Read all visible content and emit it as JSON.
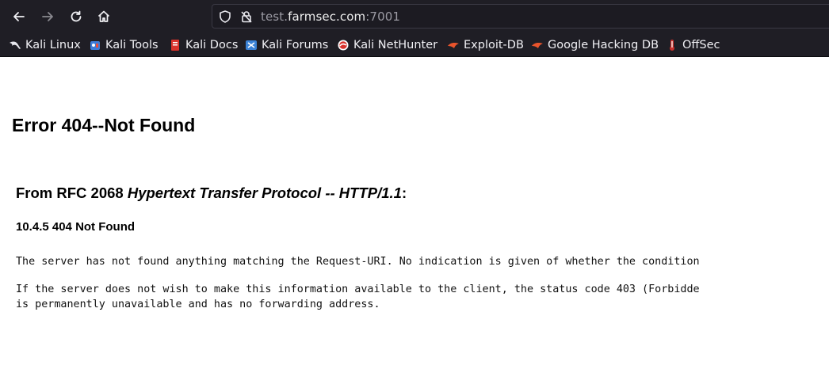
{
  "browser": {
    "url_subdomain": "test.",
    "url_domain": "farmsec.com",
    "url_port": ":7001",
    "bookmarks": [
      {
        "label": "Kali Linux",
        "icon": "kali-dragon-icon"
      },
      {
        "label": "Kali Tools",
        "icon": "kali-tools-icon"
      },
      {
        "label": "Kali Docs",
        "icon": "kali-docs-icon"
      },
      {
        "label": "Kali Forums",
        "icon": "kali-forums-icon"
      },
      {
        "label": "Kali NetHunter",
        "icon": "kali-nethunter-icon"
      },
      {
        "label": "Exploit-DB",
        "icon": "exploit-db-icon"
      },
      {
        "label": "Google Hacking DB",
        "icon": "google-hacking-db-icon"
      },
      {
        "label": "OffSec",
        "icon": "offsec-icon"
      }
    ]
  },
  "page": {
    "heading": "Error 404--Not Found",
    "rfc_prefix": "From RFC 2068 ",
    "rfc_title": "Hypertext Transfer Protocol -- HTTP/1.1",
    "rfc_suffix": ":",
    "section": "10.4.5 404 Not Found",
    "paragraph1": "The server has not found anything matching the Request-URI. No indication is given of whether the condition",
    "paragraph2_line1": "If the server does not wish to make this information available to the client, the status code 403 (Forbidde",
    "paragraph2_line2": "is permanently unavailable and has no forwarding address."
  }
}
